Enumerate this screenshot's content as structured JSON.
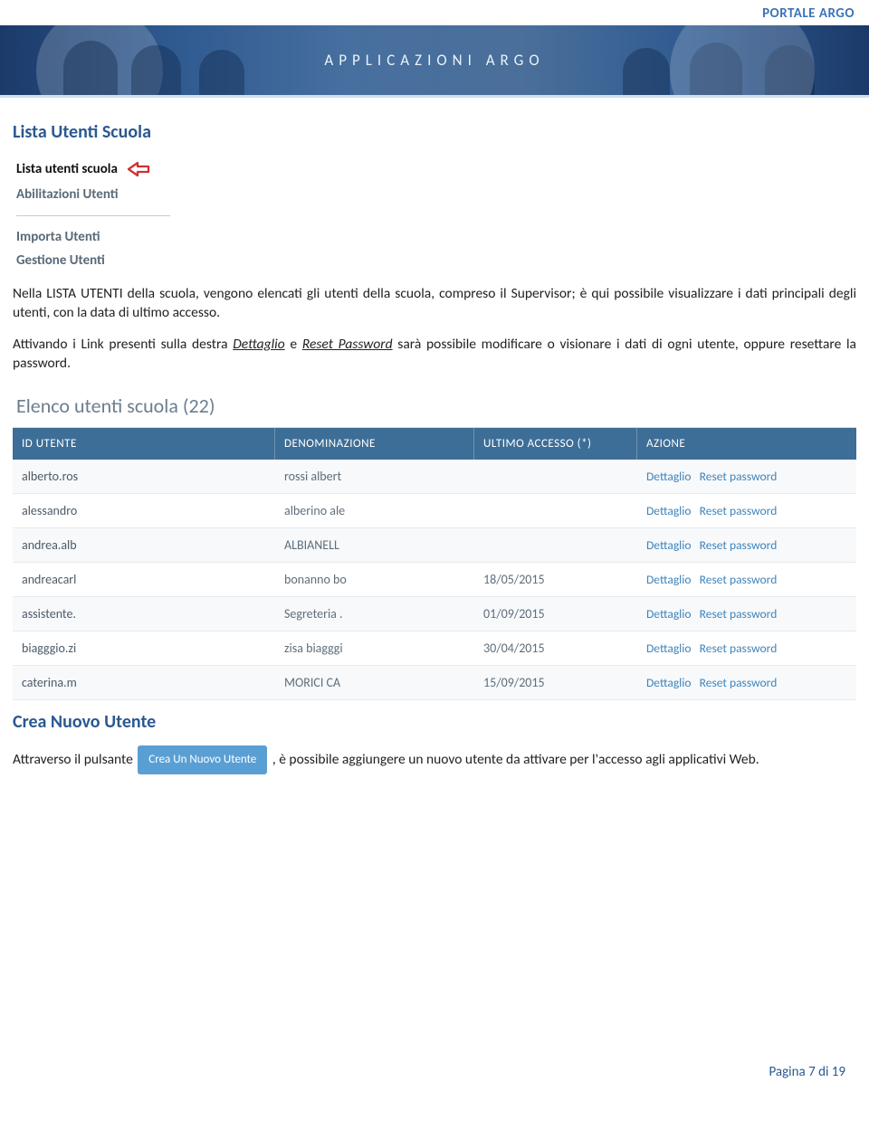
{
  "brand": "PORTALE ARGO",
  "banner_title": "APPLICAZIONI ARGO",
  "section1_title": "Lista Utenti Scuola",
  "menu": {
    "item1": "Lista utenti scuola",
    "item2": "Abilitazioni Utenti",
    "item3": "Importa Utenti",
    "item4": "Gestione Utenti"
  },
  "para1_a": "Nella LISTA UTENTI della scuola, vengono elencati  gli utenti della scuola, compreso il Supervisor; è qui possibile visualizzare i dati principali degli utenti, con la data di ultimo accesso.",
  "para2_a": "Attivando i Link presenti sulla destra ",
  "para2_link1": "Dettaglio",
  "para2_mid": " e ",
  "para2_link2": "Reset Password",
  "para2_b": "  sarà possibile modificare o visionare i dati di ogni utente, oppure resettare la password.",
  "table_title": "Elenco utenti scuola (22)",
  "th": {
    "id": "ID UTENTE",
    "den": "DENOMINAZIONE",
    "acc": "ULTIMO ACCESSO (*)",
    "act": "AZIONE"
  },
  "action_links": {
    "dettaglio": "Dettaglio",
    "reset": "Reset password"
  },
  "rows": [
    {
      "id": "alberto.ros",
      "den": "rossi albert",
      "acc": ""
    },
    {
      "id": "alessandro",
      "den": "alberino ale",
      "acc": ""
    },
    {
      "id": "andrea.alb",
      "den": "ALBIANELL",
      "acc": ""
    },
    {
      "id": "andreacarl",
      "den": "bonanno bo",
      "acc": "18/05/2015"
    },
    {
      "id": "assistente.",
      "den": "Segreteria .",
      "acc": "01/09/2015"
    },
    {
      "id": "biagggio.zi",
      "den": "zisa biagggi",
      "acc": "30/04/2015"
    },
    {
      "id": "caterina.m",
      "den": "MORICI CA",
      "acc": "15/09/2015"
    }
  ],
  "section2_title": "Crea Nuovo Utente",
  "para3_a": "Attraverso il pulsante ",
  "btn_create": "Crea Un Nuovo Utente",
  "para3_b": ", è possibile aggiungere un nuovo utente da attivare per l'accesso agli applicativi Web.",
  "footer": "Pagina 7 di 19"
}
